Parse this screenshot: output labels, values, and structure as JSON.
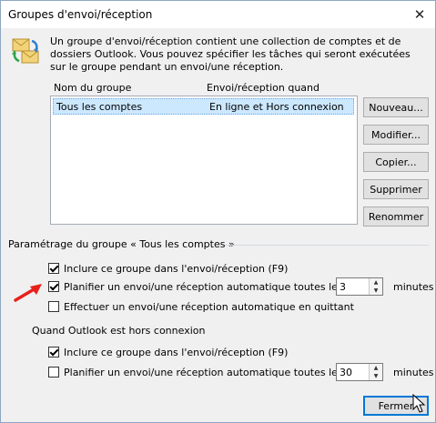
{
  "window": {
    "title": "Groupes d'envoi/réception",
    "close_glyph": "✕"
  },
  "description": "Un groupe d'envoi/réception contient une collection de comptes et de dossiers Outlook. Vous pouvez spécifier les tâches qui seront exécutées sur le groupe pendant un envoi/une réception.",
  "list": {
    "headers": [
      "Nom du groupe",
      "Envoi/réception quand"
    ],
    "rows": [
      {
        "name": "Tous les comptes",
        "when": "En ligne et Hors connexion",
        "selected": true
      }
    ]
  },
  "buttons": {
    "new": "Nouveau...",
    "modify": "Modifier...",
    "copy": "Copier...",
    "delete": "Supprimer",
    "rename": "Renommer",
    "close": "Fermer"
  },
  "online_section": {
    "label": "Paramétrage du groupe « Tous les comptes »",
    "include": {
      "label": "Inclure ce groupe dans l'envoi/réception (F9)",
      "checked": true
    },
    "schedule": {
      "label": "Planifier un envoi/une réception automatique toutes les",
      "checked": true,
      "value": "3",
      "unit": "minutes"
    },
    "on_exit": {
      "label": "Effectuer un envoi/une réception automatique en quittant",
      "checked": false
    }
  },
  "offline_section": {
    "label": "Quand Outlook est hors connexion",
    "include": {
      "label": "Inclure ce groupe dans l'envoi/réception (F9)",
      "checked": true
    },
    "schedule": {
      "label": "Planifier un envoi/une réception automatique toutes les",
      "checked": false,
      "value": "30",
      "unit": "minutes"
    }
  },
  "colors": {
    "selection": "#cce8ff",
    "default_button_border": "#0078d7",
    "annotation_arrow": "#e8201c"
  },
  "icons": {
    "dialog": "send-receive-icon",
    "annotation": "red-arrow-icon",
    "pointer": "mouse-cursor-icon"
  }
}
